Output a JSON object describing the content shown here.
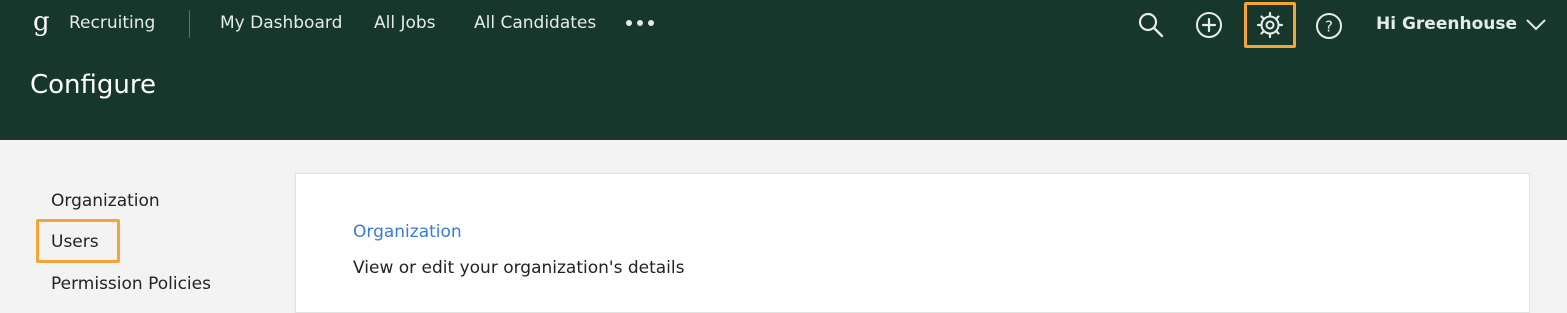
{
  "header": {
    "product_name": "Recruiting",
    "nav": [
      {
        "label": "My Dashboard"
      },
      {
        "label": "All Jobs"
      },
      {
        "label": "All Candidates"
      }
    ],
    "more_icon": "more-horizontal-icon",
    "icons": [
      "search-icon",
      "plus-circle-icon",
      "gear-icon",
      "help-icon"
    ],
    "user_greeting": "Hi Greenhouse",
    "page_title": "Configure"
  },
  "sidebar": {
    "items": [
      {
        "label": "Organization"
      },
      {
        "label": "Users"
      },
      {
        "label": "Permission Policies"
      }
    ]
  },
  "main": {
    "section_link": "Organization",
    "section_description": "View or edit your organization's details"
  },
  "colors": {
    "header_bg": "#17372c",
    "highlight": "#f5a536",
    "link": "#3a7bd5",
    "page_bg": "#f3f3f3"
  }
}
